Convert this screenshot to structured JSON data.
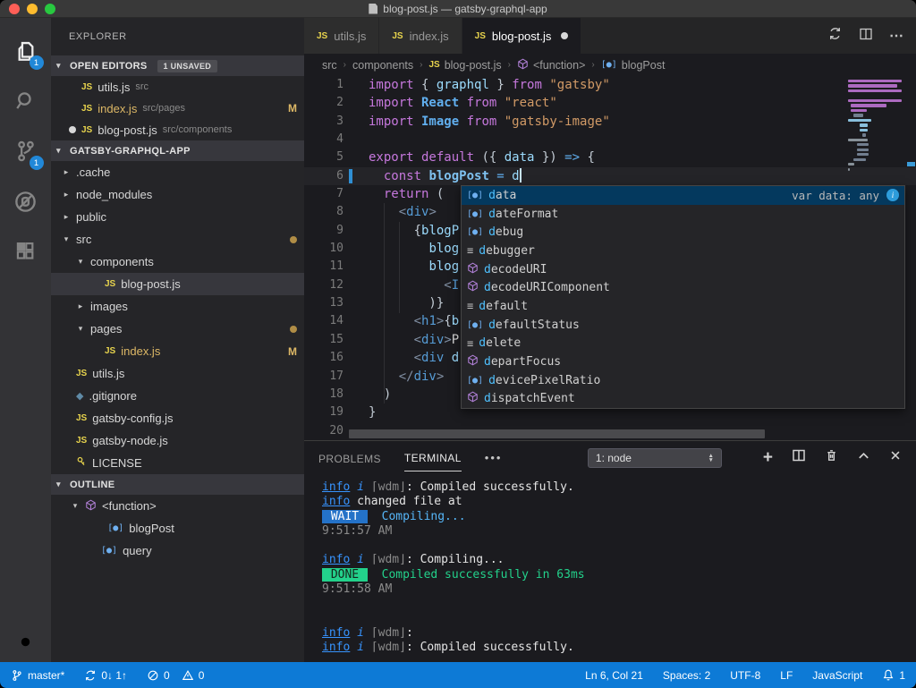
{
  "colors": {
    "accent": "#0d7ad6",
    "badge": "#2188d8",
    "modified_gold": "#ddb866",
    "error_red": "#ff5f57"
  },
  "window": {
    "title": "blog-post.js — gatsby-graphql-app"
  },
  "activity_bar": {
    "items": [
      {
        "name": "explorer",
        "badge": "1",
        "active": true
      },
      {
        "name": "search"
      },
      {
        "name": "source-control",
        "badge": "1"
      },
      {
        "name": "debug"
      },
      {
        "name": "extensions"
      }
    ],
    "settings": "settings"
  },
  "sidebar": {
    "title": "EXPLORER",
    "open_editors": {
      "label": "OPEN EDITORS",
      "badge": "1 UNSAVED",
      "items": [
        {
          "icon": "js",
          "label": "utils.js",
          "desc": "src"
        },
        {
          "icon": "js",
          "label": "index.js",
          "desc": "src/pages",
          "badge": "M",
          "gold": true
        },
        {
          "icon": "js",
          "label": "blog-post.js",
          "desc": "src/components",
          "dirty": true
        }
      ]
    },
    "project": {
      "label": "GATSBY-GRAPHQL-APP",
      "items": [
        {
          "indent": 0,
          "arrow": "collapsed",
          "label": ".cache"
        },
        {
          "indent": 0,
          "arrow": "collapsed",
          "label": "node_modules"
        },
        {
          "indent": 0,
          "arrow": "collapsed",
          "label": "public"
        },
        {
          "indent": 0,
          "arrow": "expanded",
          "label": "src",
          "dot": true
        },
        {
          "indent": 1,
          "arrow": "expanded",
          "label": "components"
        },
        {
          "indent": 2,
          "icon": "js",
          "label": "blog-post.js",
          "selected": true
        },
        {
          "indent": 1,
          "arrow": "collapsed",
          "label": "images"
        },
        {
          "indent": 1,
          "arrow": "expanded",
          "label": "pages",
          "dot": true
        },
        {
          "indent": 2,
          "icon": "js",
          "label": "index.js",
          "badge": "M",
          "gold": true
        },
        {
          "indent": 0,
          "icon": "js",
          "label": "utils.js"
        },
        {
          "indent": 0,
          "icon": "diamond",
          "label": ".gitignore"
        },
        {
          "indent": 0,
          "icon": "js",
          "label": "gatsby-config.js"
        },
        {
          "indent": 0,
          "icon": "js",
          "label": "gatsby-node.js"
        },
        {
          "indent": 0,
          "icon": "key",
          "label": "LICENSE"
        }
      ]
    },
    "outline": {
      "label": "OUTLINE",
      "items": [
        {
          "indent": 0,
          "arrow": "expanded",
          "icon": "fn",
          "label": "<function>"
        },
        {
          "indent": 1.4,
          "icon": "var",
          "label": "blogPost"
        },
        {
          "indent": 1,
          "icon": "var",
          "label": "query"
        }
      ]
    }
  },
  "tabs": [
    {
      "label": "utils.js"
    },
    {
      "label": "index.js"
    },
    {
      "label": "blog-post.js",
      "active": true,
      "dirty": true
    }
  ],
  "breadcrumbs": [
    {
      "label": "src"
    },
    {
      "label": "components"
    },
    {
      "label": "blog-post.js",
      "icon": "js"
    },
    {
      "label": "<function>",
      "icon": "fn"
    },
    {
      "label": "blogPost",
      "icon": "var"
    }
  ],
  "editor": {
    "cursor": {
      "line": 6,
      "col": 21
    },
    "lines": [
      {
        "segs": [
          [
            "k",
            "import"
          ],
          [
            "p",
            " { "
          ],
          [
            "v",
            "graphql"
          ],
          [
            "p",
            " } "
          ],
          [
            "k",
            "from"
          ],
          [
            "s",
            " \"gatsby\""
          ]
        ]
      },
      {
        "segs": [
          [
            "k",
            "import"
          ],
          [
            "t",
            " React "
          ],
          [
            "k",
            "from"
          ],
          [
            "s",
            " \"react\""
          ]
        ]
      },
      {
        "segs": [
          [
            "k",
            "import"
          ],
          [
            "t",
            " Image "
          ],
          [
            "k",
            "from"
          ],
          [
            "s",
            " \"gatsby-image\""
          ]
        ]
      },
      {
        "segs": []
      },
      {
        "segs": [
          [
            "k",
            "export"
          ],
          [
            "k",
            " default"
          ],
          [
            "p",
            " ({ "
          ],
          [
            "v",
            "data"
          ],
          [
            "p",
            " }) "
          ],
          [
            "o",
            "=>"
          ],
          [
            "p",
            " {"
          ]
        ]
      },
      {
        "segs": [
          [
            "p",
            "  "
          ],
          [
            "k",
            "const"
          ],
          [
            "f",
            " blogPost"
          ],
          [
            "o",
            " = "
          ],
          [
            "v",
            "d"
          ]
        ],
        "cursor": true,
        "gitmark": true,
        "current": true
      },
      {
        "segs": [
          [
            "p",
            "  "
          ],
          [
            "k",
            "return"
          ],
          [
            "p",
            " ("
          ]
        ]
      },
      {
        "segs": [
          [
            "p",
            "    "
          ],
          [
            "ab",
            "<"
          ],
          [
            "tg",
            "div"
          ],
          [
            "ab",
            ">"
          ]
        ]
      },
      {
        "segs": [
          [
            "p",
            "      {"
          ],
          [
            "v",
            "blogP"
          ]
        ]
      },
      {
        "segs": [
          [
            "p",
            "        "
          ],
          [
            "v",
            "blog"
          ]
        ]
      },
      {
        "segs": [
          [
            "p",
            "        "
          ],
          [
            "v",
            "blog"
          ]
        ]
      },
      {
        "segs": [
          [
            "p",
            "          "
          ],
          [
            "ab",
            "<"
          ],
          [
            "tg",
            "I"
          ]
        ]
      },
      {
        "segs": [
          [
            "p",
            "        )}"
          ]
        ]
      },
      {
        "segs": [
          [
            "p",
            "      "
          ],
          [
            "ab",
            "<"
          ],
          [
            "tg",
            "h1"
          ],
          [
            "ab",
            ">"
          ],
          [
            "p",
            "{"
          ],
          [
            "v",
            "b"
          ]
        ]
      },
      {
        "segs": [
          [
            "p",
            "      "
          ],
          [
            "ab",
            "<"
          ],
          [
            "tg",
            "div"
          ],
          [
            "ab",
            ">"
          ],
          [
            "x",
            "P"
          ]
        ]
      },
      {
        "segs": [
          [
            "p",
            "      "
          ],
          [
            "ab",
            "<"
          ],
          [
            "tg",
            "div"
          ],
          [
            "v",
            " d"
          ]
        ]
      },
      {
        "segs": [
          [
            "p",
            "    "
          ],
          [
            "ab",
            "</"
          ],
          [
            "tg",
            "div"
          ],
          [
            "ab",
            ">"
          ]
        ]
      },
      {
        "segs": [
          [
            "p",
            "  )"
          ]
        ]
      },
      {
        "segs": [
          [
            "p",
            "}"
          ]
        ]
      },
      {
        "segs": []
      }
    ]
  },
  "suggest": {
    "prefix": "d",
    "items": [
      {
        "type": "var",
        "label": "data",
        "selected": true,
        "detail": "var data: any"
      },
      {
        "type": "var",
        "label": "dateFormat"
      },
      {
        "type": "var",
        "label": "debug"
      },
      {
        "type": "kw",
        "label": "debugger"
      },
      {
        "type": "fn",
        "label": "decodeURI"
      },
      {
        "type": "fn",
        "label": "decodeURIComponent"
      },
      {
        "type": "kw",
        "label": "default"
      },
      {
        "type": "var",
        "label": "defaultStatus"
      },
      {
        "type": "kw",
        "label": "delete"
      },
      {
        "type": "fn",
        "label": "departFocus"
      },
      {
        "type": "var",
        "label": "devicePixelRatio"
      },
      {
        "type": "fn",
        "label": "dispatchEvent"
      }
    ]
  },
  "panel": {
    "tabs": [
      {
        "label": "PROBLEMS"
      },
      {
        "label": "TERMINAL",
        "active": true
      }
    ],
    "more": "•••",
    "select_value": "1: node",
    "terminal": [
      {
        "segs": [
          [
            "inf",
            "info"
          ],
          [
            "w",
            " "
          ],
          [
            "ii",
            "i"
          ],
          [
            "dim",
            " ⌈wdm⌋"
          ],
          [
            "w",
            ": Compiled successfully."
          ]
        ]
      },
      {
        "segs": [
          [
            "inf",
            "info"
          ],
          [
            "w",
            " changed file at"
          ]
        ]
      },
      {
        "segs": [
          [
            "wait",
            " WAIT "
          ],
          [
            "blue",
            "  Compiling..."
          ]
        ]
      },
      {
        "segs": [
          [
            "time",
            "9:51:57 AM"
          ]
        ]
      },
      {
        "segs": []
      },
      {
        "segs": [
          [
            "inf",
            "info"
          ],
          [
            "w",
            " "
          ],
          [
            "ii",
            "i"
          ],
          [
            "dim",
            " ⌈wdm⌋"
          ],
          [
            "w",
            ": Compiling..."
          ]
        ]
      },
      {
        "segs": [
          [
            "done",
            " DONE "
          ],
          [
            "grn",
            "  Compiled successfully in 63ms"
          ]
        ]
      },
      {
        "segs": [
          [
            "time",
            "9:51:58 AM"
          ]
        ]
      },
      {
        "segs": []
      },
      {
        "segs": []
      },
      {
        "segs": [
          [
            "inf",
            "info"
          ],
          [
            "w",
            " "
          ],
          [
            "ii",
            "i"
          ],
          [
            "dim",
            " ⌈wdm⌋"
          ],
          [
            "w",
            ": "
          ]
        ]
      },
      {
        "segs": [
          [
            "inf",
            "info"
          ],
          [
            "w",
            " "
          ],
          [
            "ii",
            "i"
          ],
          [
            "dim",
            " ⌈wdm⌋"
          ],
          [
            "w",
            ": Compiled successfully."
          ]
        ]
      }
    ]
  },
  "status_bar": {
    "branch": "master*",
    "sync": "0↓ 1↑",
    "errors": "0",
    "warnings": "0",
    "line_col": "Ln 6, Col 21",
    "spaces": "Spaces: 2",
    "encoding": "UTF-8",
    "eol": "LF",
    "language": "JavaScript",
    "notifications": "1"
  }
}
